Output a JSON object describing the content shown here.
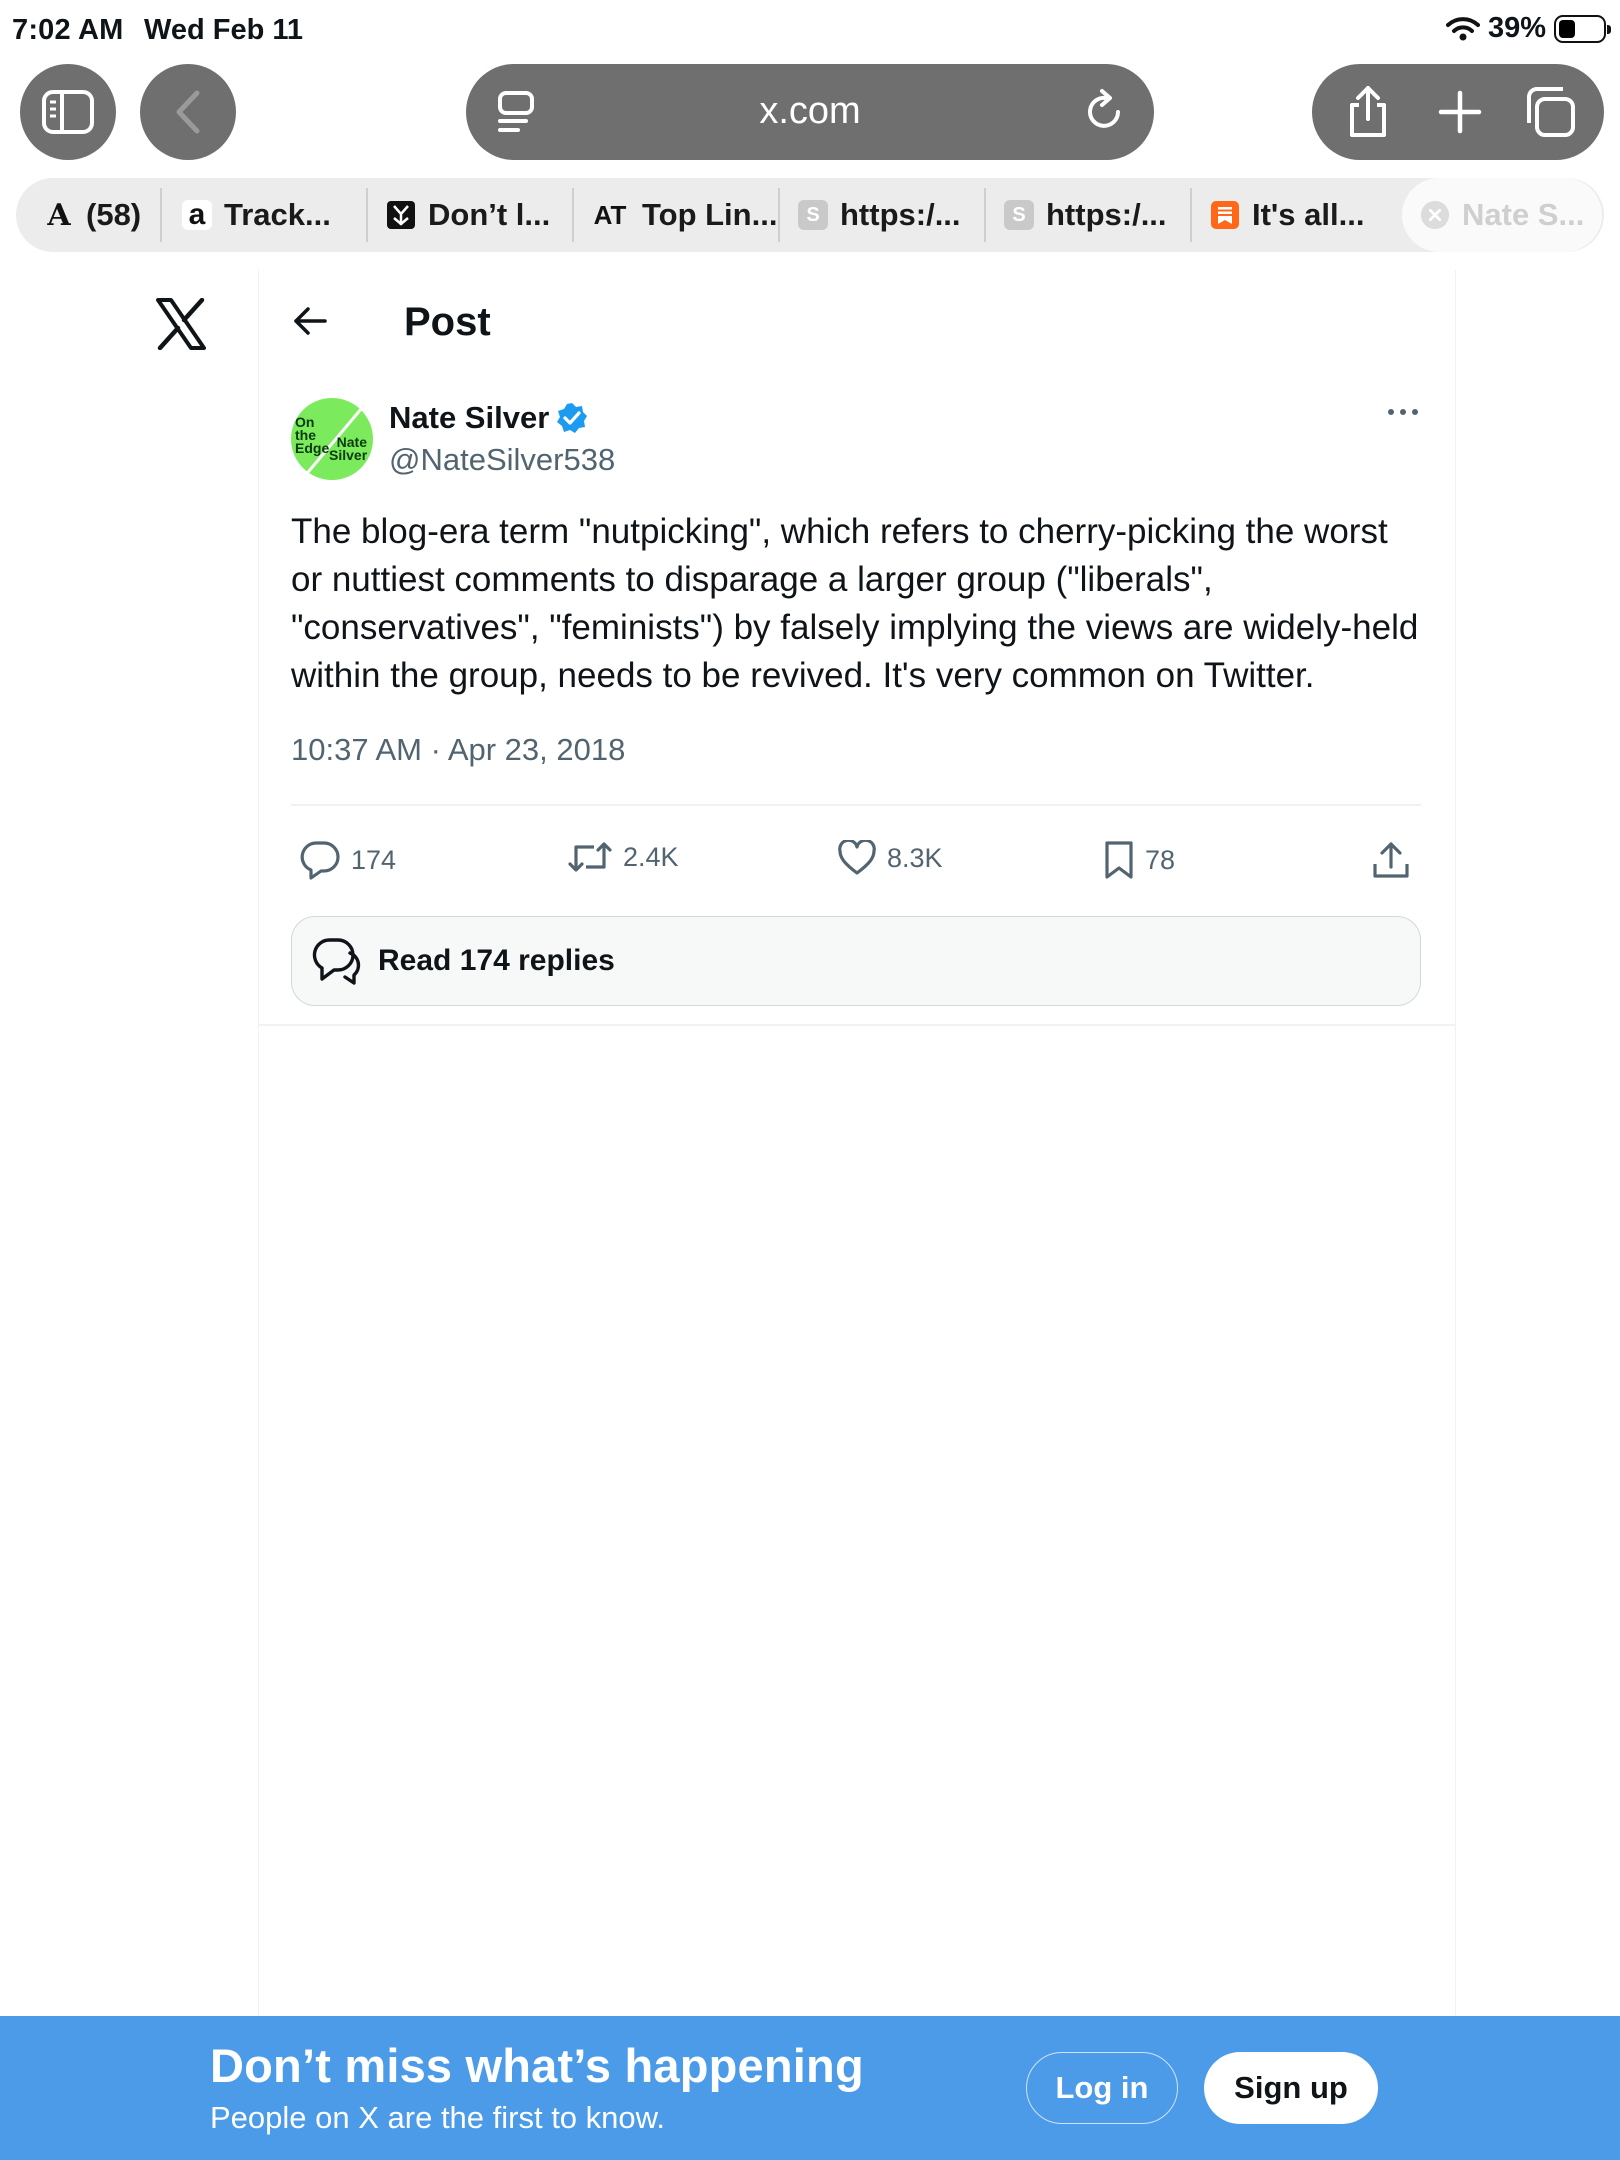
{
  "status_bar": {
    "time": "7:02 AM",
    "date": "Wed Feb 11",
    "battery_percent": "39%",
    "battery_level": 0.39
  },
  "browser": {
    "url_domain": "x.com",
    "tabs": [
      {
        "label": "(58)",
        "favicon": "A",
        "icon": "nyt-icon"
      },
      {
        "label": "Track...",
        "favicon": "a",
        "icon": "amazon-icon"
      },
      {
        "label": "Don’t l...",
        "favicon": "",
        "icon": "shield-logo-icon"
      },
      {
        "label": "Top Lin...",
        "favicon": "AT",
        "icon": "at-icon"
      },
      {
        "label": "https:/...",
        "favicon": "S",
        "icon": "s-letter-icon"
      },
      {
        "label": "https:/...",
        "favicon": "S",
        "icon": "s-letter-icon"
      },
      {
        "label": "It's all...",
        "favicon": "",
        "icon": "substack-icon"
      },
      {
        "label": "Nate S...",
        "favicon": "",
        "icon": "close-icon",
        "active": true
      }
    ]
  },
  "page": {
    "header_title": "Post",
    "author": {
      "name": "Nate Silver",
      "handle": "@NateSilver538",
      "verified": true,
      "avatar_text_1": "On the Edge",
      "avatar_text_2": "Nate Silver"
    },
    "tweet_text": "The blog-era term \"nutpicking\", which refers to cherry-picking the worst or nuttiest comments to disparage a larger group (\"liberals\", \"conservatives\", \"feminists\") by falsely implying the views are widely-held within the group, needs to be revived. It's very common on Twitter.",
    "timestamp": "10:37 AM · Apr 23, 2018",
    "stats": {
      "replies": "174",
      "reposts": "2.4K",
      "likes": "8.3K",
      "bookmarks": "78"
    },
    "read_replies_label": "Read 174 replies"
  },
  "banner": {
    "headline": "Don’t miss what’s happening",
    "subtext": "People on X are the first to know.",
    "login_label": "Log in",
    "signup_label": "Sign up"
  },
  "colors": {
    "banner_blue": "#4b9be8",
    "verified_blue": "#1d9bf0",
    "secondary_text": "#536471",
    "toolbar_gray": "#6f6f6f",
    "avatar_green": "#7bea5d"
  }
}
